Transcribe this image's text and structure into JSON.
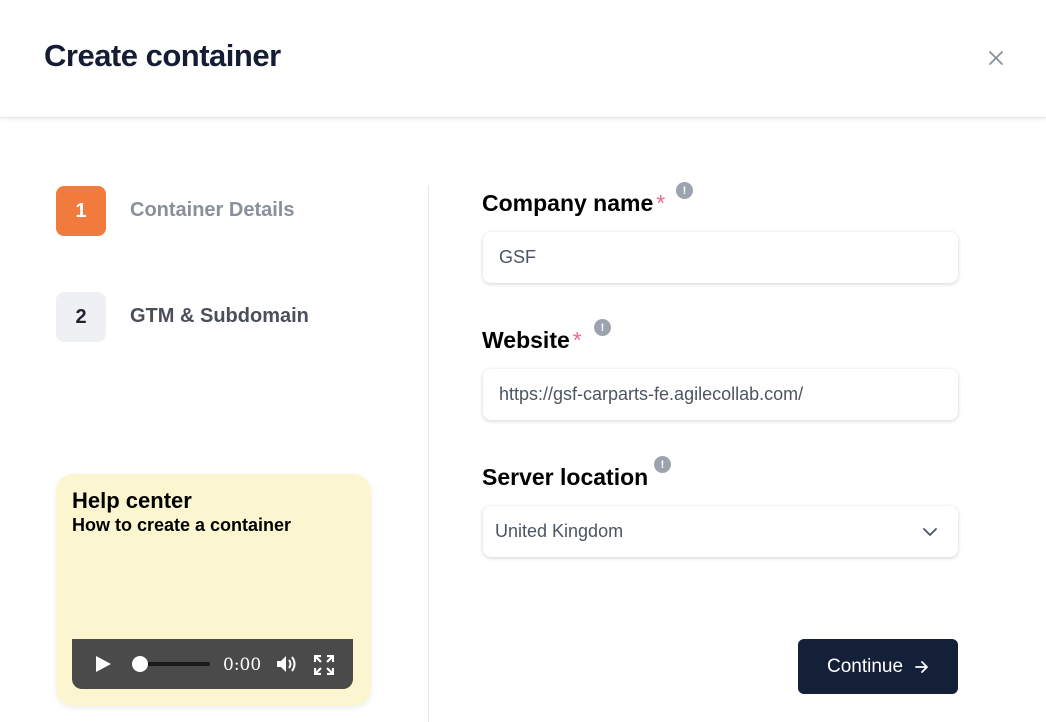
{
  "dialog": {
    "title": "Create container"
  },
  "steps": [
    {
      "number": "1",
      "label": "Container Details",
      "state": "active"
    },
    {
      "number": "2",
      "label": "GTM & Subdomain",
      "state": "inactive"
    }
  ],
  "help": {
    "title": "Help center",
    "subtitle": "How to create a container",
    "video_time": "0:00"
  },
  "form": {
    "company": {
      "label": "Company name",
      "required_mark": "*",
      "value": "GSF"
    },
    "website": {
      "label": "Website",
      "required_mark": "*",
      "value": "https://gsf-carparts-fe.agilecollab.com/"
    },
    "server": {
      "label": "Server location",
      "value": "United Kingdom"
    },
    "info_glyph": "!"
  },
  "actions": {
    "continue_label": "Continue"
  },
  "colors": {
    "accent": "#f07b3c",
    "primary_button": "#142038",
    "required": "#f06a8a",
    "help_bg": "#fbf6cf"
  }
}
